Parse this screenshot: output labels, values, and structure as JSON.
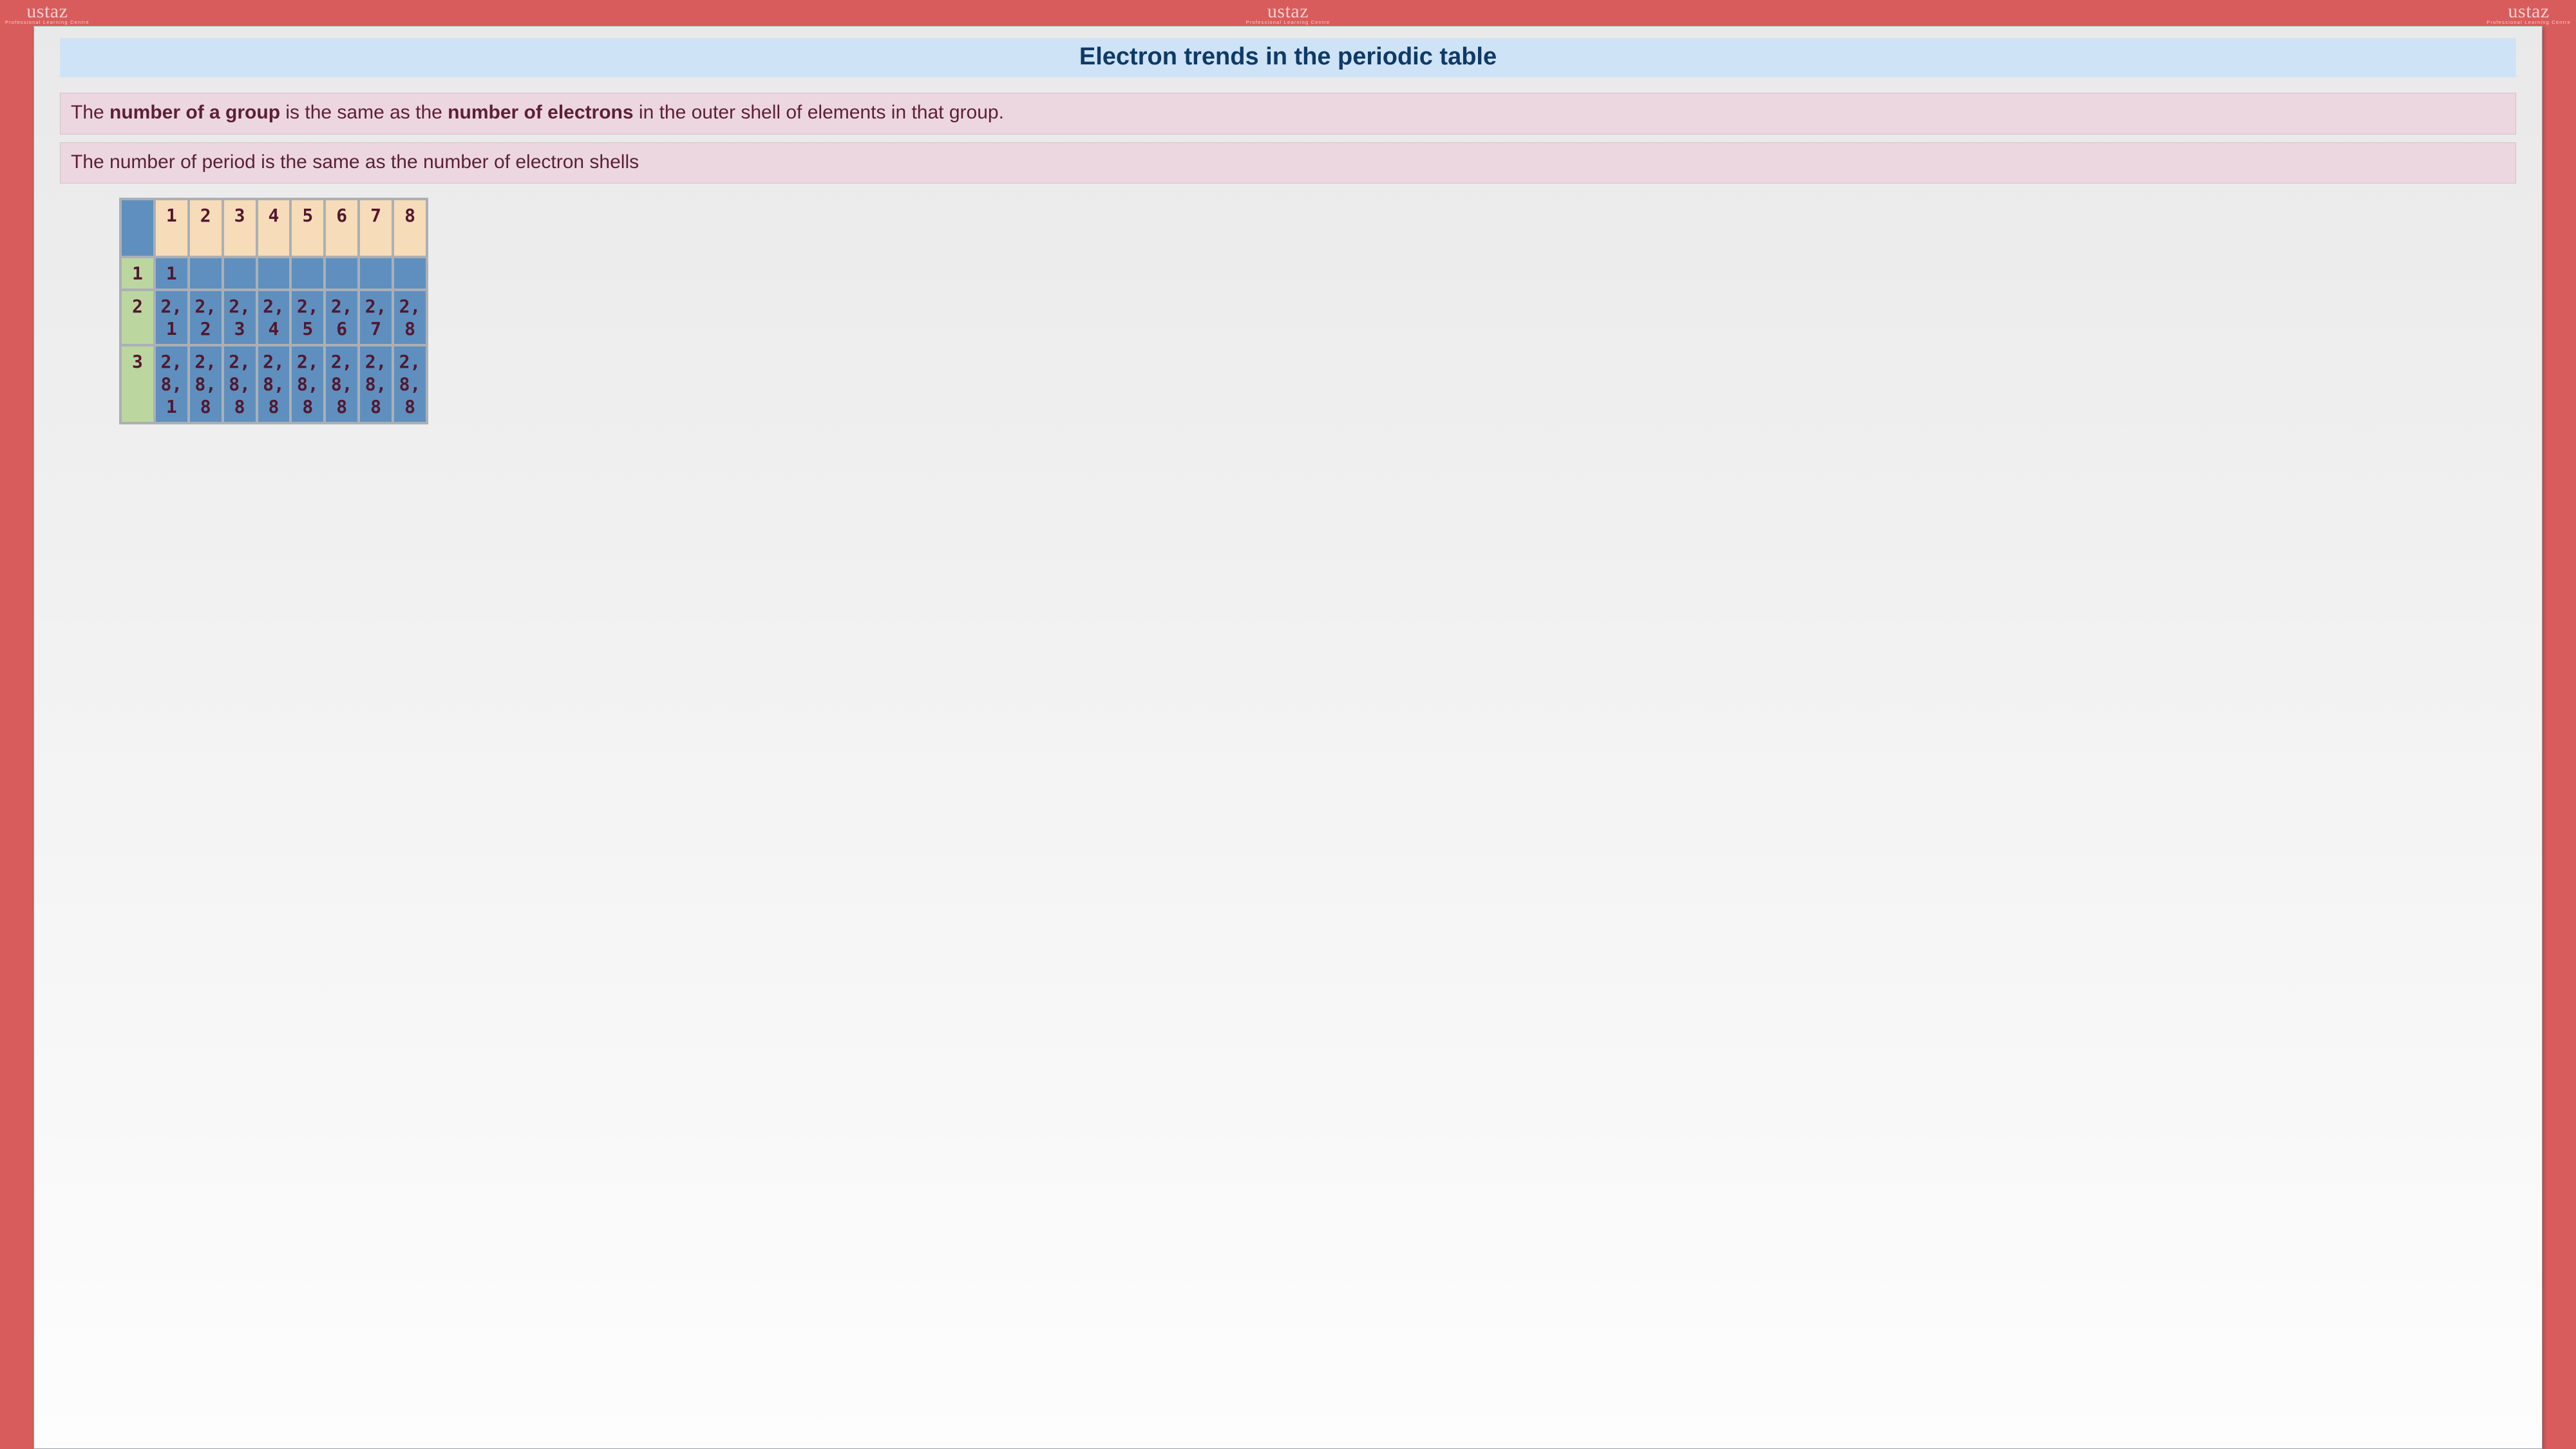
{
  "logo": {
    "brand": "ustaz",
    "tagline": "Professional  Learning  Centre"
  },
  "title": "Electron trends in the periodic table",
  "info1": {
    "pre": "The ",
    "b1": "number of a group",
    "mid": " is the same as the ",
    "b2": "number of electrons",
    "post": " in the outer shell of elements in that group."
  },
  "info2": "The number of period is the same as the number of electron shells",
  "table": {
    "col_headers": [
      "1",
      "2",
      "3",
      "4",
      "5",
      "6",
      "7",
      "8"
    ],
    "rows": [
      {
        "head": "1",
        "cells": [
          "1",
          "",
          "",
          "",
          "",
          "",
          "",
          ""
        ]
      },
      {
        "head": "2",
        "cells": [
          "2,1",
          "2,2",
          "2,3",
          "2,4",
          "2,5",
          "2,6",
          "2,7",
          "2,8"
        ]
      },
      {
        "head": "3",
        "cells": [
          "2,8,1",
          "2,8,8",
          "2,8,8",
          "2,8,8",
          "2,8,8",
          "2,8,8",
          "2,8,8",
          "2,8,8"
        ]
      }
    ]
  }
}
